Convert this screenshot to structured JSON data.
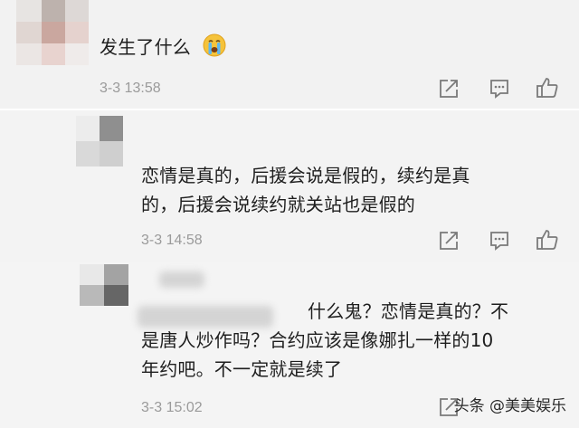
{
  "comments": [
    {
      "text_lines": [
        "发生了什么"
      ],
      "emoji": "crying-face",
      "timestamp": "3-3 13:58"
    },
    {
      "text_lines": [
        "恋情是真的，后援会说是假的，续约是真",
        "的，后援会说续约就关站也是假的"
      ],
      "timestamp": "3-3 14:58"
    },
    {
      "text_lines": [
        "什么鬼？恋情是真的？不",
        "是唐人炒作吗？合约应该是像娜扎一样的10",
        "年约吧。不一定就是续了"
      ],
      "timestamp": "3-3 15:02"
    }
  ],
  "actions": {
    "share_icon": "share-icon",
    "comment_icon": "comment-icon",
    "like_icon": "thumbs-up-icon"
  },
  "watermark": {
    "text": "头条 @美美娱乐"
  },
  "colors": {
    "text": "#1e1e1e",
    "time": "#9a9a9a",
    "icon": "#7a7a7a",
    "emoji": "#f5c33b"
  }
}
